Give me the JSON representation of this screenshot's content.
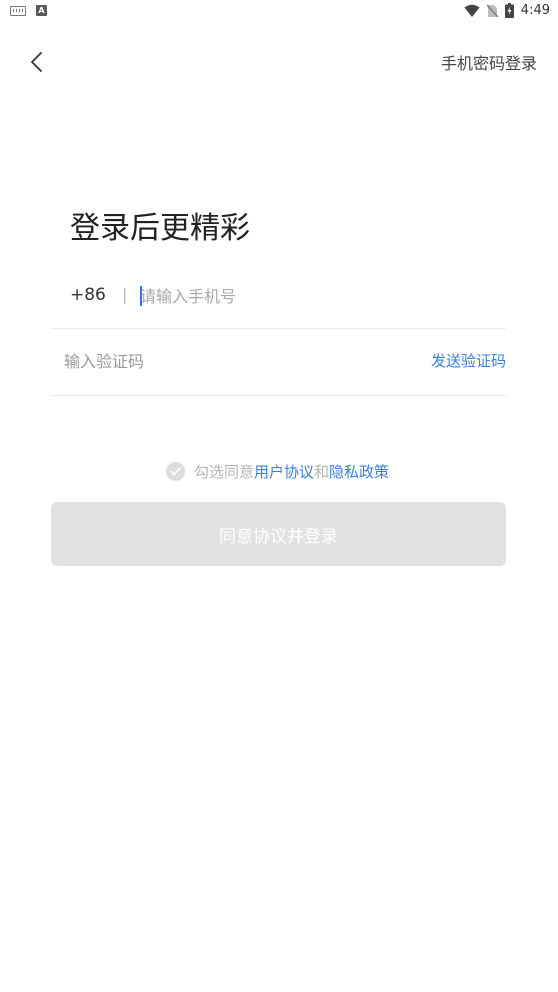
{
  "status_bar": {
    "time": "4:49",
    "left_icons": [
      "keyboard-icon",
      "a-app-icon"
    ],
    "right_icons": [
      "wifi-icon",
      "no-sim-icon",
      "battery-charging-icon"
    ]
  },
  "nav": {
    "back_icon": "chevron-left-icon",
    "password_login_label": "手机密码登录"
  },
  "title": "登录后更精彩",
  "phone": {
    "country_code": "+86",
    "separator": "|",
    "placeholder": "请输入手机号",
    "value": ""
  },
  "code": {
    "placeholder": "输入验证码",
    "value": "",
    "send_label": "发送验证码"
  },
  "agreement": {
    "prefix": "勾选同意",
    "user_agreement": "用户协议",
    "and": "和",
    "privacy_policy": "隐私政策",
    "checked": false
  },
  "submit_label": "同意协议并登录",
  "colors": {
    "accent": "#3a7fd8",
    "disabled_button": "#e1e1e1",
    "caret": "#3b6fe0"
  }
}
